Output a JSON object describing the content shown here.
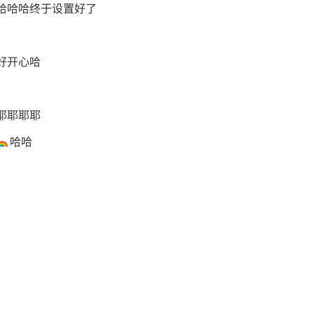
{
  "feed": {
    "lines": [
      {
        "text": "哈哈哈终于设置好了"
      },
      {
        "text": "好开心哈"
      },
      {
        "text": "耶耶耶耶"
      },
      {
        "icon": "rainbow-icon",
        "text": "哈哈"
      }
    ]
  }
}
